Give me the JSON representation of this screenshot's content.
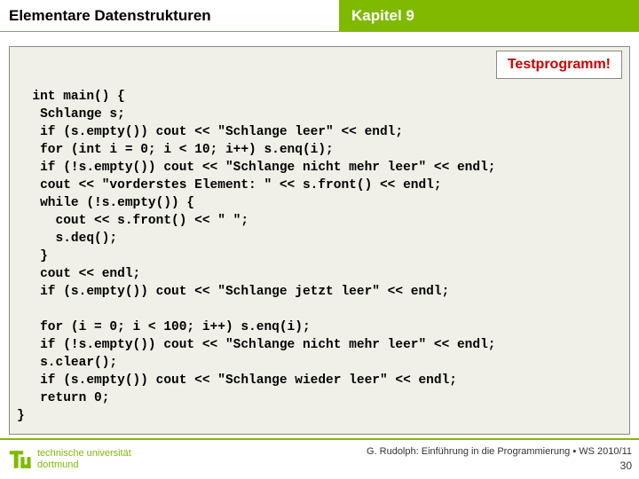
{
  "header": {
    "left": "Elementare Datenstrukturen",
    "right": "Kapitel 9"
  },
  "badge": "Testprogramm!",
  "code": "int main() {\n   Schlange s;\n   if (s.empty()) cout << \"Schlange leer\" << endl;\n   for (int i = 0; i < 10; i++) s.enq(i);\n   if (!s.empty()) cout << \"Schlange nicht mehr leer\" << endl;\n   cout << \"vorderstes Element: \" << s.front() << endl;\n   while (!s.empty()) {\n     cout << s.front() << \" \";\n     s.deq();\n   }\n   cout << endl;\n   if (s.empty()) cout << \"Schlange jetzt leer\" << endl;\n\n   for (i = 0; i < 100; i++) s.enq(i);\n   if (!s.empty()) cout << \"Schlange nicht mehr leer\" << endl;\n   s.clear();\n   if (s.empty()) cout << \"Schlange wieder leer\" << endl;\n   return 0;\n}",
  "logo": {
    "line1": "technische universität",
    "line2": "dortmund"
  },
  "footer": {
    "credit": "G. Rudolph: Einführung in die Programmierung ▪ WS 2010/11",
    "page": "30"
  }
}
